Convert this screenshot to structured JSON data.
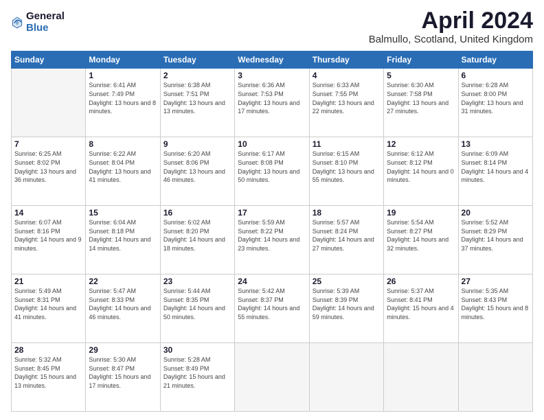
{
  "logo": {
    "general": "General",
    "blue": "Blue"
  },
  "title": "April 2024",
  "location": "Balmullo, Scotland, United Kingdom",
  "weekdays": [
    "Sunday",
    "Monday",
    "Tuesday",
    "Wednesday",
    "Thursday",
    "Friday",
    "Saturday"
  ],
  "weeks": [
    [
      {
        "day": "",
        "sunrise": "",
        "sunset": "",
        "daylight": "",
        "empty": true
      },
      {
        "day": "1",
        "sunrise": "Sunrise: 6:41 AM",
        "sunset": "Sunset: 7:49 PM",
        "daylight": "Daylight: 13 hours and 8 minutes."
      },
      {
        "day": "2",
        "sunrise": "Sunrise: 6:38 AM",
        "sunset": "Sunset: 7:51 PM",
        "daylight": "Daylight: 13 hours and 13 minutes."
      },
      {
        "day": "3",
        "sunrise": "Sunrise: 6:36 AM",
        "sunset": "Sunset: 7:53 PM",
        "daylight": "Daylight: 13 hours and 17 minutes."
      },
      {
        "day": "4",
        "sunrise": "Sunrise: 6:33 AM",
        "sunset": "Sunset: 7:55 PM",
        "daylight": "Daylight: 13 hours and 22 minutes."
      },
      {
        "day": "5",
        "sunrise": "Sunrise: 6:30 AM",
        "sunset": "Sunset: 7:58 PM",
        "daylight": "Daylight: 13 hours and 27 minutes."
      },
      {
        "day": "6",
        "sunrise": "Sunrise: 6:28 AM",
        "sunset": "Sunset: 8:00 PM",
        "daylight": "Daylight: 13 hours and 31 minutes."
      }
    ],
    [
      {
        "day": "7",
        "sunrise": "Sunrise: 6:25 AM",
        "sunset": "Sunset: 8:02 PM",
        "daylight": "Daylight: 13 hours and 36 minutes."
      },
      {
        "day": "8",
        "sunrise": "Sunrise: 6:22 AM",
        "sunset": "Sunset: 8:04 PM",
        "daylight": "Daylight: 13 hours and 41 minutes."
      },
      {
        "day": "9",
        "sunrise": "Sunrise: 6:20 AM",
        "sunset": "Sunset: 8:06 PM",
        "daylight": "Daylight: 13 hours and 46 minutes."
      },
      {
        "day": "10",
        "sunrise": "Sunrise: 6:17 AM",
        "sunset": "Sunset: 8:08 PM",
        "daylight": "Daylight: 13 hours and 50 minutes."
      },
      {
        "day": "11",
        "sunrise": "Sunrise: 6:15 AM",
        "sunset": "Sunset: 8:10 PM",
        "daylight": "Daylight: 13 hours and 55 minutes."
      },
      {
        "day": "12",
        "sunrise": "Sunrise: 6:12 AM",
        "sunset": "Sunset: 8:12 PM",
        "daylight": "Daylight: 14 hours and 0 minutes."
      },
      {
        "day": "13",
        "sunrise": "Sunrise: 6:09 AM",
        "sunset": "Sunset: 8:14 PM",
        "daylight": "Daylight: 14 hours and 4 minutes."
      }
    ],
    [
      {
        "day": "14",
        "sunrise": "Sunrise: 6:07 AM",
        "sunset": "Sunset: 8:16 PM",
        "daylight": "Daylight: 14 hours and 9 minutes."
      },
      {
        "day": "15",
        "sunrise": "Sunrise: 6:04 AM",
        "sunset": "Sunset: 8:18 PM",
        "daylight": "Daylight: 14 hours and 14 minutes."
      },
      {
        "day": "16",
        "sunrise": "Sunrise: 6:02 AM",
        "sunset": "Sunset: 8:20 PM",
        "daylight": "Daylight: 14 hours and 18 minutes."
      },
      {
        "day": "17",
        "sunrise": "Sunrise: 5:59 AM",
        "sunset": "Sunset: 8:22 PM",
        "daylight": "Daylight: 14 hours and 23 minutes."
      },
      {
        "day": "18",
        "sunrise": "Sunrise: 5:57 AM",
        "sunset": "Sunset: 8:24 PM",
        "daylight": "Daylight: 14 hours and 27 minutes."
      },
      {
        "day": "19",
        "sunrise": "Sunrise: 5:54 AM",
        "sunset": "Sunset: 8:27 PM",
        "daylight": "Daylight: 14 hours and 32 minutes."
      },
      {
        "day": "20",
        "sunrise": "Sunrise: 5:52 AM",
        "sunset": "Sunset: 8:29 PM",
        "daylight": "Daylight: 14 hours and 37 minutes."
      }
    ],
    [
      {
        "day": "21",
        "sunrise": "Sunrise: 5:49 AM",
        "sunset": "Sunset: 8:31 PM",
        "daylight": "Daylight: 14 hours and 41 minutes."
      },
      {
        "day": "22",
        "sunrise": "Sunrise: 5:47 AM",
        "sunset": "Sunset: 8:33 PM",
        "daylight": "Daylight: 14 hours and 46 minutes."
      },
      {
        "day": "23",
        "sunrise": "Sunrise: 5:44 AM",
        "sunset": "Sunset: 8:35 PM",
        "daylight": "Daylight: 14 hours and 50 minutes."
      },
      {
        "day": "24",
        "sunrise": "Sunrise: 5:42 AM",
        "sunset": "Sunset: 8:37 PM",
        "daylight": "Daylight: 14 hours and 55 minutes."
      },
      {
        "day": "25",
        "sunrise": "Sunrise: 5:39 AM",
        "sunset": "Sunset: 8:39 PM",
        "daylight": "Daylight: 14 hours and 59 minutes."
      },
      {
        "day": "26",
        "sunrise": "Sunrise: 5:37 AM",
        "sunset": "Sunset: 8:41 PM",
        "daylight": "Daylight: 15 hours and 4 minutes."
      },
      {
        "day": "27",
        "sunrise": "Sunrise: 5:35 AM",
        "sunset": "Sunset: 8:43 PM",
        "daylight": "Daylight: 15 hours and 8 minutes."
      }
    ],
    [
      {
        "day": "28",
        "sunrise": "Sunrise: 5:32 AM",
        "sunset": "Sunset: 8:45 PM",
        "daylight": "Daylight: 15 hours and 13 minutes."
      },
      {
        "day": "29",
        "sunrise": "Sunrise: 5:30 AM",
        "sunset": "Sunset: 8:47 PM",
        "daylight": "Daylight: 15 hours and 17 minutes."
      },
      {
        "day": "30",
        "sunrise": "Sunrise: 5:28 AM",
        "sunset": "Sunset: 8:49 PM",
        "daylight": "Daylight: 15 hours and 21 minutes."
      },
      {
        "day": "",
        "sunrise": "",
        "sunset": "",
        "daylight": "",
        "empty": true
      },
      {
        "day": "",
        "sunrise": "",
        "sunset": "",
        "daylight": "",
        "empty": true
      },
      {
        "day": "",
        "sunrise": "",
        "sunset": "",
        "daylight": "",
        "empty": true
      },
      {
        "day": "",
        "sunrise": "",
        "sunset": "",
        "daylight": "",
        "empty": true
      }
    ]
  ]
}
